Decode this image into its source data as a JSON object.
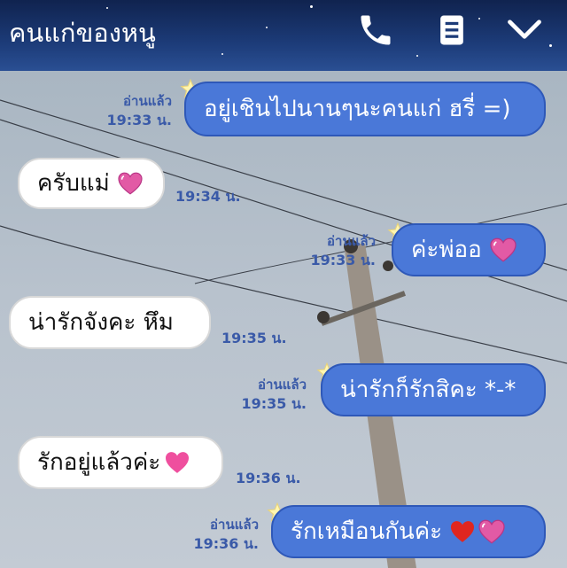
{
  "header": {
    "title": "คนแก่ของหนู"
  },
  "messages": [
    {
      "dir": "out",
      "text": "อยู่เชินไปนานๆนะคนแก่ ฮรี่ =)",
      "read": "อ่านแล้ว",
      "time": "19:33 น."
    },
    {
      "dir": "in",
      "text": "ครับแม่",
      "time": "19:34 น."
    },
    {
      "dir": "out",
      "text": "ค่ะพ่ออ",
      "read": "อ่านแล้ว",
      "time": "19:33 น."
    },
    {
      "dir": "in",
      "text": "น่ารักจังคะ หึม",
      "time": "19:35 น."
    },
    {
      "dir": "out",
      "text": "น่ารักก็รักสิคะ *-*",
      "read": "อ่านแล้ว",
      "time": "19:35 น."
    },
    {
      "dir": "in",
      "text": "รักอยู่แล้วค่ะ",
      "time": "19:36 น."
    },
    {
      "dir": "out",
      "text": "รักเหมือนกันค่ะ",
      "read": "อ่านแล้ว",
      "time": "19:36 น."
    }
  ],
  "colors": {
    "outgoing_bubble": "#4a78d8",
    "incoming_bubble": "#ffffff",
    "meta_text": "#3a5aa8",
    "header_bg": "#1c3b78"
  },
  "icons": {
    "call": "phone-icon",
    "notes": "note-icon",
    "menu": "chevron-down-icon",
    "read_marker": "star-icon",
    "heart": "heart-icon"
  }
}
